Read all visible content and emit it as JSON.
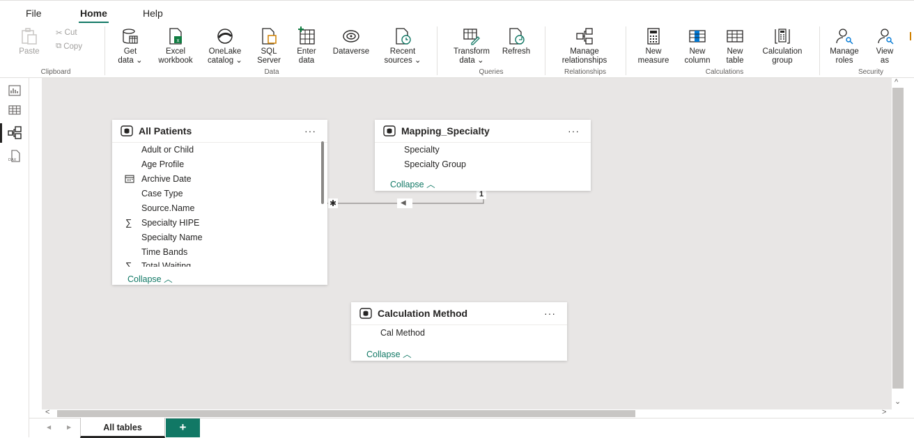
{
  "menu": {
    "file": "File",
    "home": "Home",
    "help": "Help"
  },
  "ribbon": {
    "clipboard": {
      "paste": "Paste",
      "cut": "Cut",
      "copy": "Copy",
      "label": "Clipboard"
    },
    "data": {
      "get_data": [
        "Get",
        "data ⌄"
      ],
      "excel": [
        "Excel",
        "workbook"
      ],
      "onelake": [
        "OneLake",
        "catalog ⌄"
      ],
      "sql": [
        "SQL",
        "Server"
      ],
      "enter": [
        "Enter",
        "data"
      ],
      "dataverse": [
        "Dataverse"
      ],
      "recent": [
        "Recent",
        "sources ⌄"
      ],
      "label": "Data"
    },
    "queries": {
      "transform": [
        "Transform",
        "data ⌄"
      ],
      "refresh": [
        "Refresh"
      ],
      "label": "Queries"
    },
    "relationships": {
      "manage": [
        "Manage",
        "relationships"
      ],
      "label": "Relationships"
    },
    "calculations": {
      "new_measure": [
        "New",
        "measure"
      ],
      "new_column": [
        "New",
        "column"
      ],
      "new_table": [
        "New",
        "table"
      ],
      "calc_group": [
        "Calculation",
        "group"
      ],
      "label": "Calculations"
    },
    "security": {
      "manage_roles": [
        "Manage",
        "roles"
      ],
      "view_as": [
        "View",
        "as"
      ],
      "label": "Security"
    }
  },
  "tables": {
    "all_patients": {
      "title": "All Patients",
      "more": "···",
      "fields": [
        "Adult or Child",
        "Age Profile",
        "Archive Date",
        "Case Type",
        "Source.Name",
        "Specialty HIPE",
        "Specialty Name",
        "Time Bands",
        "Total Waiting"
      ],
      "collapse": "Collapse ︿"
    },
    "mapping_specialty": {
      "title": "Mapping_Specialty",
      "more": "···",
      "fields": [
        "Specialty",
        "Specialty Group"
      ],
      "collapse": "Collapse ︿"
    },
    "calculation_method": {
      "title": "Calculation Method",
      "more": "···",
      "fields": [
        "Cal Method"
      ],
      "collapse": "Collapse ︿"
    }
  },
  "relationship": {
    "many": "✱",
    "one": "1",
    "arrow": "◀"
  },
  "tabs": {
    "all_tables": "All tables",
    "add": "+"
  },
  "scroll": {
    "left": "<",
    "right": ">",
    "up": "^",
    "down": "⌄",
    "prev": "◀",
    "next": "▶"
  },
  "colors": {
    "accent": "#117865",
    "canvas": "#e8e6e5",
    "tab_add": "#117865"
  }
}
